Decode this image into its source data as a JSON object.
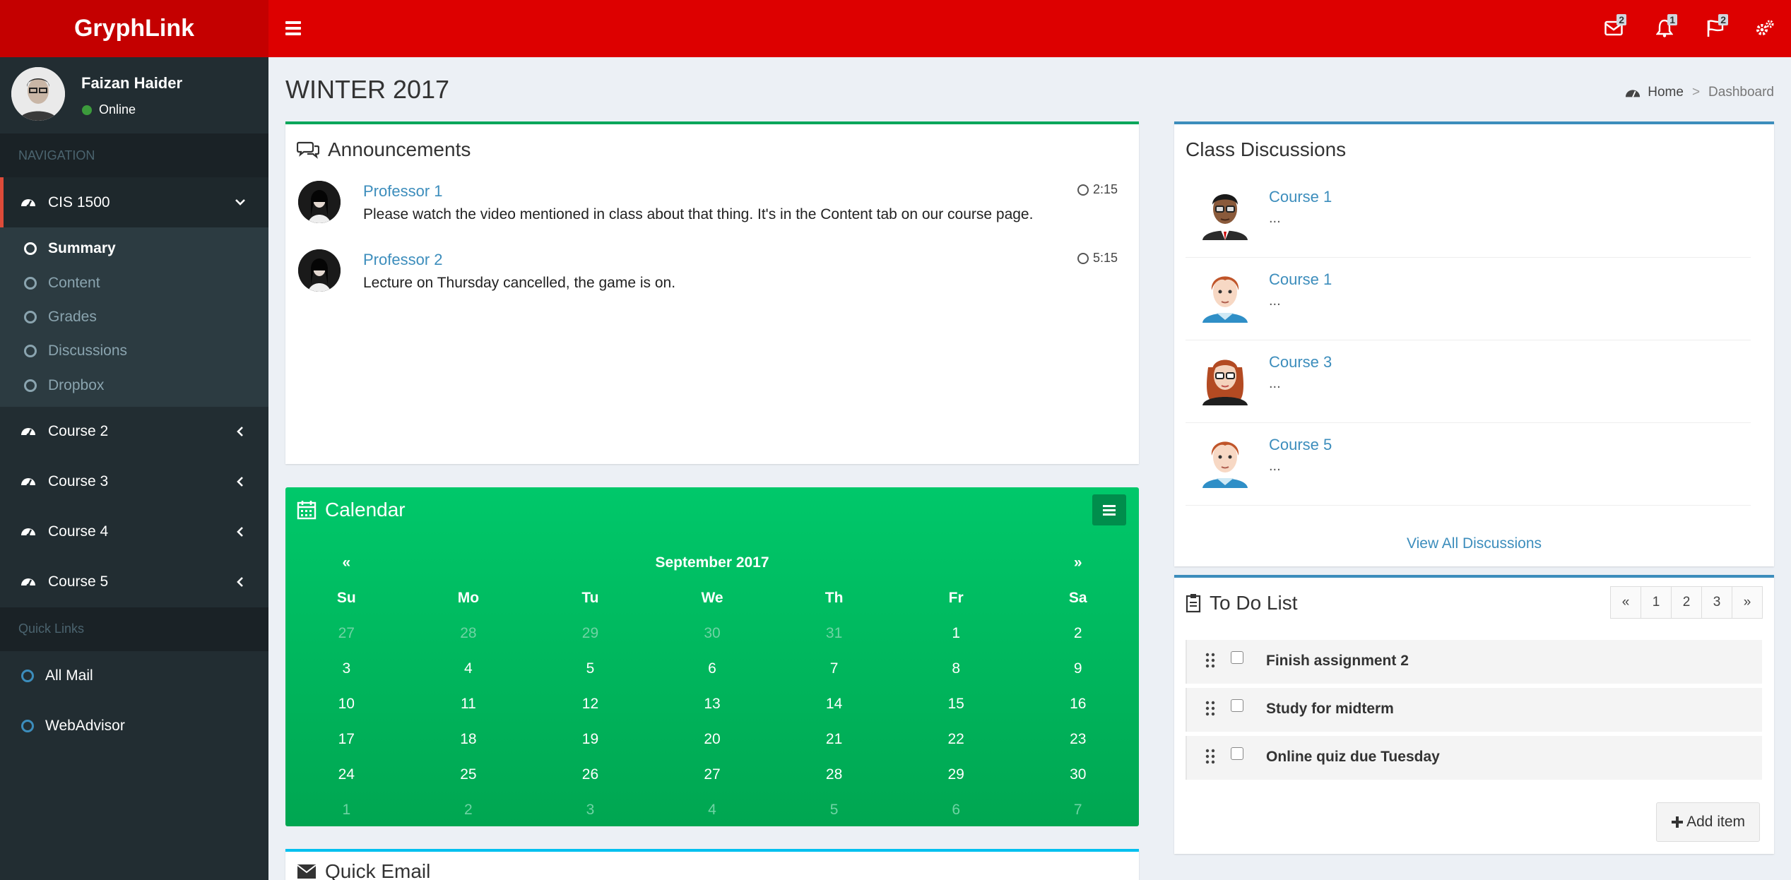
{
  "app": {
    "name": "GryphLink"
  },
  "header": {
    "menu_icon": "bars-icon",
    "icons": [
      {
        "name": "mail-icon",
        "badge": "2"
      },
      {
        "name": "bell-icon",
        "badge": "1"
      },
      {
        "name": "flag-icon",
        "badge": "2"
      },
      {
        "name": "gears-icon",
        "badge": ""
      }
    ]
  },
  "user": {
    "name": "Faizan Haider",
    "status": "Online",
    "status_color": "#3c9b3c"
  },
  "sidebar": {
    "nav_header": "NAVIGATION",
    "active_course": "CIS 1500",
    "submenu": [
      "Summary",
      "Content",
      "Grades",
      "Discussions",
      "Dropbox"
    ],
    "courses": [
      "Course 2",
      "Course 3",
      "Course 4",
      "Course 5"
    ],
    "quick_header": "Quick Links",
    "quick_links": [
      "All Mail",
      "WebAdvisor"
    ]
  },
  "page": {
    "title": "WINTER 2017"
  },
  "breadcrumb": {
    "home": "Home",
    "sep": ">",
    "current": "Dashboard"
  },
  "announcements": {
    "title": "Announcements",
    "items": [
      {
        "author": "Professor 1",
        "time": "2:15",
        "message": "Please watch the video mentioned in class about that thing. It's in the Content tab on our course page."
      },
      {
        "author": "Professor 2",
        "time": "5:15",
        "message": "Lecture on Thursday cancelled, the game is on."
      }
    ]
  },
  "calendar": {
    "title": "Calendar",
    "month": "September 2017",
    "prev": "«",
    "next": "»",
    "weekdays": [
      "Su",
      "Mo",
      "Tu",
      "We",
      "Th",
      "Fr",
      "Sa"
    ],
    "weeks": [
      [
        {
          "d": "27",
          "old": true
        },
        {
          "d": "28",
          "old": true
        },
        {
          "d": "29",
          "old": true
        },
        {
          "d": "30",
          "old": true
        },
        {
          "d": "31",
          "old": true
        },
        {
          "d": "1"
        },
        {
          "d": "2"
        }
      ],
      [
        {
          "d": "3"
        },
        {
          "d": "4"
        },
        {
          "d": "5"
        },
        {
          "d": "6"
        },
        {
          "d": "7"
        },
        {
          "d": "8"
        },
        {
          "d": "9"
        }
      ],
      [
        {
          "d": "10"
        },
        {
          "d": "11"
        },
        {
          "d": "12"
        },
        {
          "d": "13"
        },
        {
          "d": "14"
        },
        {
          "d": "15"
        },
        {
          "d": "16"
        }
      ],
      [
        {
          "d": "17"
        },
        {
          "d": "18"
        },
        {
          "d": "19"
        },
        {
          "d": "20"
        },
        {
          "d": "21"
        },
        {
          "d": "22"
        },
        {
          "d": "23"
        }
      ],
      [
        {
          "d": "24"
        },
        {
          "d": "25"
        },
        {
          "d": "26"
        },
        {
          "d": "27"
        },
        {
          "d": "28"
        },
        {
          "d": "29"
        },
        {
          "d": "30"
        }
      ],
      [
        {
          "d": "1",
          "old": true
        },
        {
          "d": "2",
          "old": true
        },
        {
          "d": "3",
          "old": true
        },
        {
          "d": "4",
          "old": true
        },
        {
          "d": "5",
          "old": true
        },
        {
          "d": "6",
          "old": true
        },
        {
          "d": "7",
          "old": true
        }
      ]
    ]
  },
  "quick_email": {
    "title": "Quick Email"
  },
  "discussions": {
    "title": "Class Discussions",
    "items": [
      {
        "course": "Course 1",
        "snippet": "...",
        "avatar": "man-glasses"
      },
      {
        "course": "Course 1",
        "snippet": "...",
        "avatar": "redhead-boy"
      },
      {
        "course": "Course 3",
        "snippet": "...",
        "avatar": "woman-glasses"
      },
      {
        "course": "Course 5",
        "snippet": "...",
        "avatar": "redhead-boy"
      }
    ],
    "view_all": "View All Discussions"
  },
  "todo": {
    "title": "To Do List",
    "pager": [
      "«",
      "1",
      "2",
      "3",
      "»"
    ],
    "items": [
      "Finish assignment 2",
      "Study for midterm",
      "Online quiz due Tuesday"
    ],
    "add_label": "Add item"
  },
  "colors": {
    "header": "#dd0000",
    "logo_bg": "#c40000",
    "sidebar": "#222d32",
    "link": "#3c8dbc",
    "calendar": "#00a65a",
    "accent_green": "#00a65a",
    "accent_blue": "#3c8dbc",
    "accent_aqua": "#00c0ef"
  }
}
